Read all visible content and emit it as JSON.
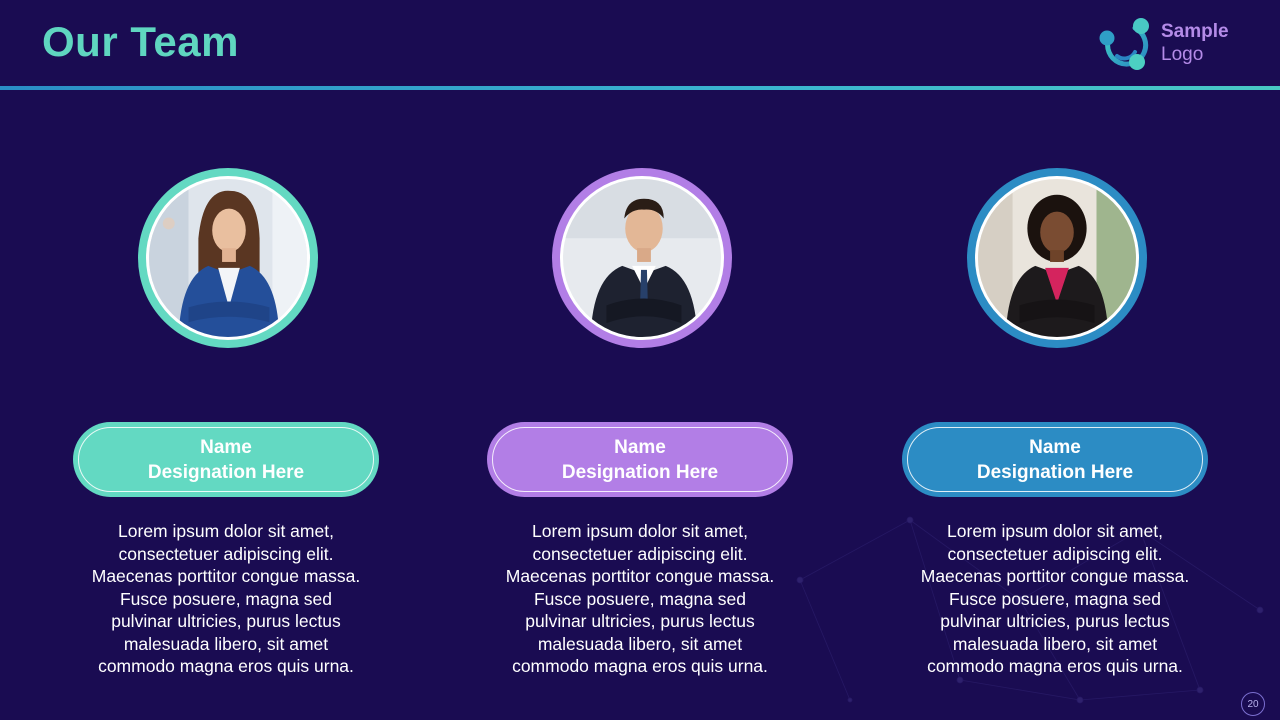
{
  "title": "Our Team",
  "logo": {
    "line1": "Sample",
    "line2": "Logo",
    "icon": "molecule-logo-icon"
  },
  "colors": {
    "background": "#1a0c52",
    "title": "#5fd6c0",
    "teal": "#63d9c2",
    "purple": "#b27ee6",
    "blue": "#2c8cc4",
    "logo_text": "#b48be8"
  },
  "members": [
    {
      "name": "Name",
      "designation": "Designation Here",
      "photo_icon": "woman-portrait-photo",
      "description_lines": [
        "Lorem ipsum dolor sit amet,",
        "consectetuer adipiscing elit.",
        "Maecenas porttitor congue massa.",
        "Fusce posuere, magna sed",
        "pulvinar ultricies, purus lectus",
        "malesuada libero, sit amet",
        "commodo magna eros quis urna."
      ]
    },
    {
      "name": "Name",
      "designation": "Designation Here",
      "photo_icon": "man-portrait-photo",
      "description_lines": [
        "Lorem ipsum dolor sit amet,",
        "consectetuer adipiscing elit.",
        "Maecenas porttitor congue massa.",
        "Fusce posuere, magna sed",
        "pulvinar ultricies, purus lectus",
        "malesuada libero, sit amet",
        "commodo magna eros quis urna."
      ]
    },
    {
      "name": "Name",
      "designation": "Designation Here",
      "photo_icon": "woman-portrait-photo",
      "description_lines": [
        "Lorem ipsum dolor sit amet,",
        "consectetuer adipiscing elit.",
        "Maecenas porttitor congue massa.",
        "Fusce posuere, magna sed",
        "pulvinar ultricies, purus lectus",
        "malesuada libero, sit amet",
        "commodo magna eros quis urna."
      ]
    }
  ],
  "page_number": "20"
}
